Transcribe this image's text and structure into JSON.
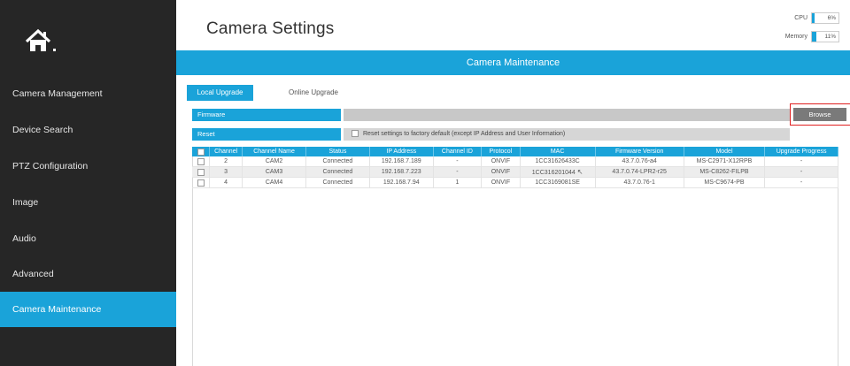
{
  "app": {
    "title": "Camera Settings"
  },
  "meters": {
    "cpu": {
      "label": "CPU",
      "value": "6%",
      "fraction": 0.06
    },
    "memory": {
      "label": "Memory",
      "value": "11%",
      "fraction": 0.11
    }
  },
  "sidebar": {
    "logo_icon": "home-icon",
    "items": [
      {
        "label": "Camera Management",
        "active": false
      },
      {
        "label": "Device Search",
        "active": false
      },
      {
        "label": "PTZ Configuration",
        "active": false
      },
      {
        "label": "Image",
        "active": false
      },
      {
        "label": "Audio",
        "active": false
      },
      {
        "label": "Advanced",
        "active": false
      },
      {
        "label": "Camera Maintenance",
        "active": true
      }
    ]
  },
  "section": {
    "title": "Camera Maintenance"
  },
  "tabs": [
    {
      "label": "Local Upgrade",
      "active": true
    },
    {
      "label": "Online Upgrade",
      "active": false
    }
  ],
  "firmware": {
    "label": "Firmware",
    "browse_label": "Browse"
  },
  "reset": {
    "label": "Reset",
    "checkbox_text": "Reset settings to factory default (except IP Address and User Information)"
  },
  "table": {
    "columns": [
      "Channel",
      "Channel Name",
      "Status",
      "IP Address",
      "Channel ID",
      "Protocol",
      "MAC",
      "Firmware Version",
      "Model",
      "Upgrade Progress"
    ],
    "rows": [
      [
        "2",
        "CAM2",
        "Connected",
        "192.168.7.189",
        "-",
        "ONVIF",
        "1CC31626433C",
        "43.7.0.76-a4",
        "MS-C2971-X12RPB",
        "-"
      ],
      [
        "3",
        "CAM3",
        "Connected",
        "192.168.7.223",
        "-",
        "ONVIF",
        "1CC316201044",
        "43.7.0.74-LPR2-r25",
        "MS-C8262-FILPB",
        "-"
      ],
      [
        "4",
        "CAM4",
        "Connected",
        "192.168.7.94",
        "1",
        "ONVIF",
        "1CC3169081SE",
        "43.7.0.76-1",
        "MS-C9674-PB",
        "-"
      ]
    ]
  },
  "colors": {
    "accent": "#1aa3d9",
    "sidebar": "#262626",
    "highlight": "#e02020"
  }
}
